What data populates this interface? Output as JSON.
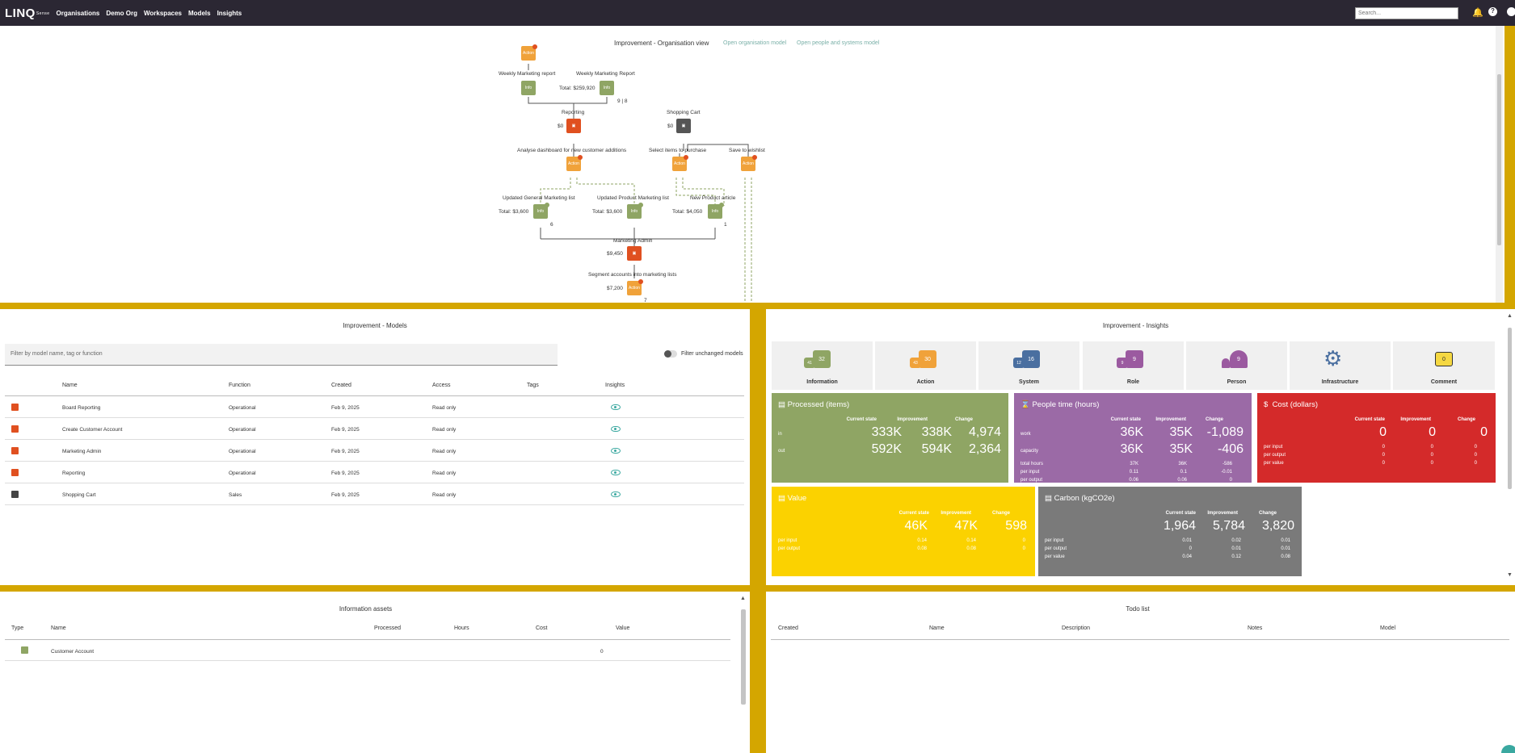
{
  "app": {
    "logo": "LINQ",
    "logo_small": "Sense",
    "nav": [
      "Organisations",
      "Demo Org",
      "Workspaces",
      "Models",
      "Insights"
    ],
    "search_placeholder": "Search..."
  },
  "org_view": {
    "title": "Improvement - Organisation view",
    "link1": "Open organisation model",
    "link2": "Open people and systems model",
    "labels": {
      "weekly_report_1": "Weekly Marketing report",
      "weekly_report_2": "Weekly Marketing Report",
      "total_259": "Total: $259,920",
      "ratio_98": "9 | 8",
      "reporting": "Reporting",
      "reporting_cost": "$0",
      "shopping_cart": "Shopping Cart",
      "shopping_cost": "$0",
      "analyse": "Analyse dashboard for new customer additions",
      "select_items": "Select items to purchase",
      "save_wishlist": "Save to wishlist",
      "upd_general": "Updated General Marketing list",
      "upd_product": "Updated Product Marketing list",
      "new_article": "New Product article",
      "total_3600a": "Total: $3,600",
      "total_3600b": "Total: $3,600",
      "total_4050": "Total: $4,050",
      "n6": "6",
      "n1": "1",
      "marketing_admin": "Marketing Admin",
      "admin_cost": "$9,450",
      "segment": "Segment accounts into marketing lists",
      "segment_cost": "$7,200",
      "n7": "7"
    },
    "node_text": {
      "action": "Action",
      "info": "Info"
    }
  },
  "models": {
    "title": "Improvement - Models",
    "filter_placeholder": "Filter by model name, tag or function",
    "filter_toggle_label": "Filter unchanged models",
    "columns": [
      "Name",
      "Function",
      "Created",
      "Access",
      "Tags",
      "Insights"
    ],
    "rows": [
      {
        "name": "Board Reporting",
        "function": "Operational",
        "created": "Feb 9, 2025",
        "access": "Read only",
        "tags": ""
      },
      {
        "name": "Create Customer Account",
        "function": "Operational",
        "created": "Feb 9, 2025",
        "access": "Read only",
        "tags": ""
      },
      {
        "name": "Marketing Admin",
        "function": "Operational",
        "created": "Feb 9, 2025",
        "access": "Read only",
        "tags": ""
      },
      {
        "name": "Reporting",
        "function": "Operational",
        "created": "Feb 9, 2025",
        "access": "Read only",
        "tags": ""
      },
      {
        "name": "Shopping Cart",
        "function": "Sales",
        "created": "Feb 9, 2025",
        "access": "Read only",
        "tags": ""
      }
    ],
    "row_icon_colors": [
      "#e05020",
      "#e05020",
      "#e05020",
      "#e05020",
      "#444444"
    ]
  },
  "insights": {
    "title": "Improvement - Insights",
    "tiles": [
      {
        "label": "Information",
        "a": "41",
        "b": "32",
        "color": "#8fa564"
      },
      {
        "label": "Action",
        "a": "43",
        "b": "30",
        "color": "#f0a23a"
      },
      {
        "label": "System",
        "a": "12",
        "b": "16",
        "color": "#4a6fa0"
      },
      {
        "label": "Role",
        "a": "9",
        "b": "9",
        "color": "#9b5aa0"
      },
      {
        "label": "Person",
        "a": "",
        "b": "9",
        "color": "#9b5aa0"
      },
      {
        "label": "Infrastructure",
        "a": "",
        "b": "",
        "color": "#4a6fa0"
      },
      {
        "label": "Comment",
        "a": "",
        "b": "0",
        "color": "#f5d842"
      }
    ],
    "col_headers": [
      "Current state",
      "Improvement",
      "Change"
    ],
    "processed": {
      "title": "Processed (items)",
      "in_label": "in",
      "in": [
        "333K",
        "338K",
        "4,974"
      ],
      "out_label": "out",
      "out": [
        "592K",
        "594K",
        "2,364"
      ]
    },
    "people": {
      "title": "People time (hours)",
      "work_label": "work",
      "work": [
        "36K",
        "35K",
        "-1,089"
      ],
      "capacity_label": "capacity",
      "capacity": [
        "36K",
        "35K",
        "-406"
      ],
      "total_label": "total hours",
      "total": [
        "37K",
        "36K",
        "-586"
      ],
      "pin_label": "per input",
      "pin": [
        "0.11",
        "0.1",
        "-0.01"
      ],
      "pout_label": "per output",
      "pout": [
        "0.06",
        "0.06",
        "0"
      ]
    },
    "cost": {
      "title": "Cost (dollars)",
      "main": [
        "0",
        "0",
        "0"
      ],
      "pin_label": "per input",
      "pin": [
        "0",
        "0",
        "0"
      ],
      "pout_label": "per output",
      "pout": [
        "0",
        "0",
        "0"
      ],
      "pval_label": "per value",
      "pval": [
        "0",
        "0",
        "0"
      ]
    },
    "value": {
      "title": "Value",
      "main": [
        "46K",
        "47K",
        "598"
      ],
      "pin_label": "per input",
      "pin": [
        "0.14",
        "0.14",
        "0"
      ],
      "pout_label": "per output",
      "pout": [
        "0.08",
        "0.08",
        "0"
      ]
    },
    "carbon": {
      "title": "Carbon (kgCO2e)",
      "main": [
        "1,964",
        "5,784",
        "3,820"
      ],
      "pin_label": "per input",
      "pin": [
        "0.01",
        "0.02",
        "0.01"
      ],
      "pout_label": "per output",
      "pout": [
        "0",
        "0.01",
        "0.01"
      ],
      "pval_label": "per value",
      "pval": [
        "0.04",
        "0.12",
        "0.08"
      ]
    },
    "card_colors": {
      "processed": "#8fa564",
      "people": "#9b6aa6",
      "cost": "#d42a2a",
      "value": "#fbd200",
      "carbon": "#7a7a7a"
    }
  },
  "assets": {
    "title": "Information assets",
    "columns": [
      "Type",
      "Name",
      "Processed",
      "Hours",
      "Cost",
      "Value"
    ],
    "rows": [
      {
        "name": "Customer Account",
        "processed": "",
        "hours": "",
        "cost": "",
        "value": "0"
      }
    ]
  },
  "todo": {
    "title": "Todo list",
    "columns": [
      "Created",
      "Name",
      "Description",
      "Notes",
      "Model"
    ]
  }
}
